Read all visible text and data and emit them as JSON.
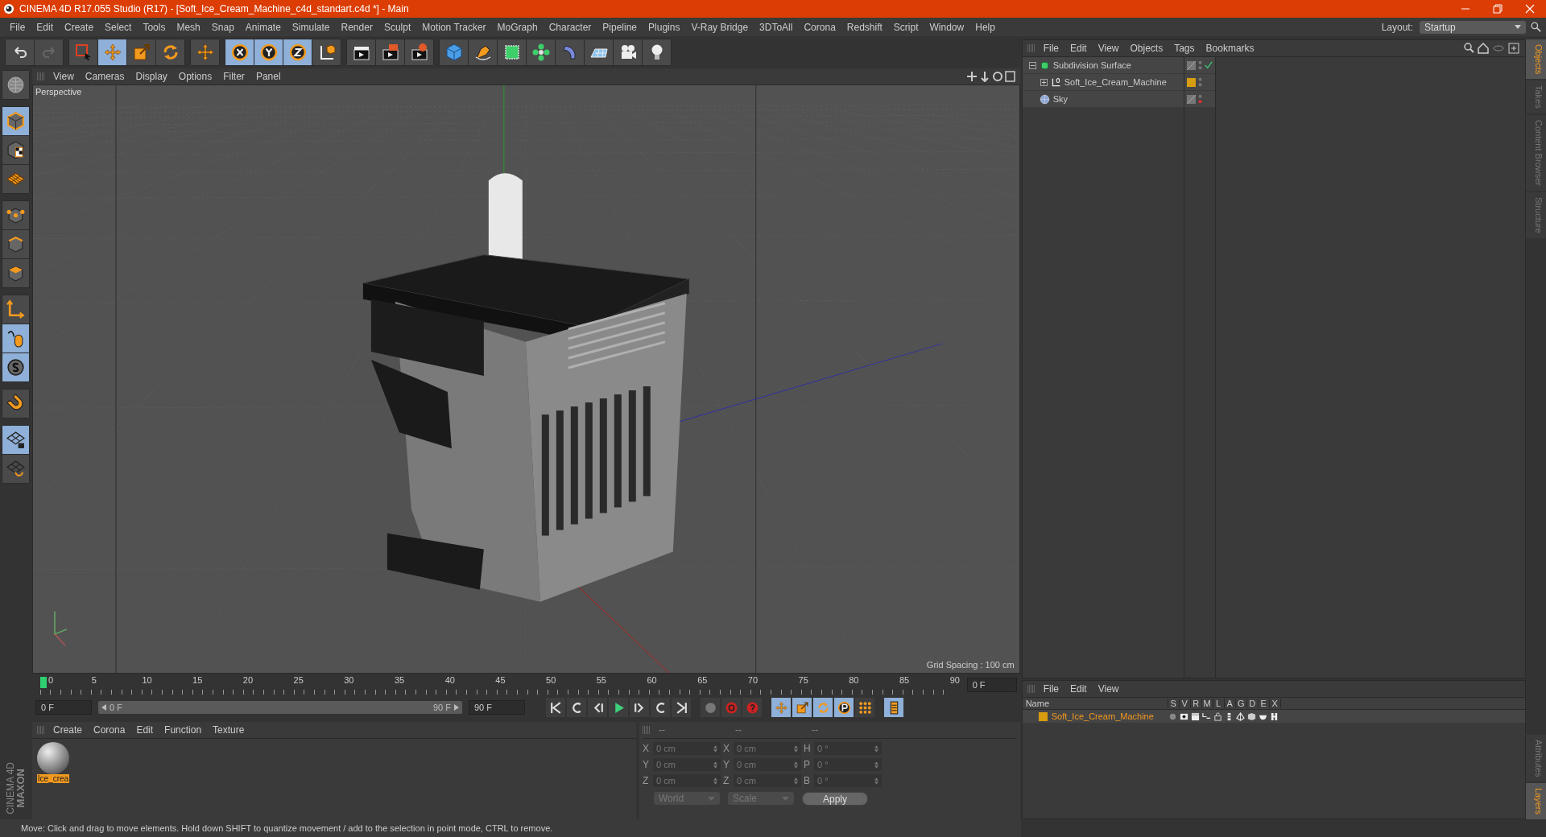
{
  "window": {
    "title": "CINEMA 4D R17.055 Studio (R17) - [Soft_Ice_Cream_Machine_c4d_standart.c4d *] - Main"
  },
  "menu": [
    "File",
    "Edit",
    "Create",
    "Select",
    "Tools",
    "Mesh",
    "Snap",
    "Animate",
    "Simulate",
    "Render",
    "Sculpt",
    "Motion Tracker",
    "MoGraph",
    "Character",
    "Pipeline",
    "Plugins",
    "V-Ray Bridge",
    "3DToAll",
    "Corona",
    "Redshift",
    "Script",
    "Window",
    "Help"
  ],
  "layout": {
    "label": "Layout:",
    "value": "Startup"
  },
  "viewport": {
    "menu": [
      "View",
      "Cameras",
      "Display",
      "Options",
      "Filter",
      "Panel"
    ],
    "camera": "Perspective",
    "grid_spacing": "Grid Spacing : 100 cm"
  },
  "timeline": {
    "ticks": [
      "0",
      "5",
      "10",
      "15",
      "20",
      "25",
      "30",
      "35",
      "40",
      "45",
      "50",
      "55",
      "60",
      "65",
      "70",
      "75",
      "80",
      "85",
      "90"
    ],
    "level": 0,
    "current_frame": "0 F",
    "start_field": "0 F",
    "range": {
      "start": "0 F",
      "end": "90 F"
    },
    "end_field": "90 F"
  },
  "material_manager": {
    "menu": [
      "Create",
      "Corona",
      "Edit",
      "Function",
      "Texture"
    ],
    "materials": [
      {
        "name": "Ice_crea",
        "selected": true
      }
    ]
  },
  "coordinates": {
    "headers": [
      "--",
      "--",
      "--"
    ],
    "rows": [
      [
        {
          "axis": "X",
          "value": "0 cm"
        },
        {
          "axis": "X",
          "value": "0 cm"
        },
        {
          "axis": "H",
          "value": "0 °"
        }
      ],
      [
        {
          "axis": "Y",
          "value": "0 cm"
        },
        {
          "axis": "Y",
          "value": "0 cm"
        },
        {
          "axis": "P",
          "value": "0 °"
        }
      ],
      [
        {
          "axis": "Z",
          "value": "0 cm"
        },
        {
          "axis": "Z",
          "value": "0 cm"
        },
        {
          "axis": "B",
          "value": "0 °"
        }
      ]
    ],
    "mode": "World",
    "transform": "Scale",
    "apply": "Apply"
  },
  "object_manager": {
    "menu": [
      "File",
      "Edit",
      "View",
      "Objects",
      "Tags",
      "Bookmarks"
    ],
    "objects": [
      {
        "name": "Subdivision Surface",
        "kind": "generator",
        "expanded": true,
        "enabled": true,
        "render_hidden": false,
        "children": [
          {
            "name": "Soft_Ice_Cream_Machine",
            "kind": "null",
            "expanded": false,
            "enabled": false,
            "render_hidden": false,
            "color": "#d89c10"
          }
        ]
      },
      {
        "name": "Sky",
        "kind": "sky",
        "enabled": false,
        "render_hidden": true
      }
    ]
  },
  "layer_manager": {
    "menu": [
      "File",
      "Edit",
      "View"
    ],
    "columns": [
      "Name",
      "S",
      "V",
      "R",
      "M",
      "L",
      "A",
      "G",
      "D",
      "E",
      "X"
    ],
    "layers": [
      {
        "name": "Soft_Ice_Cream_Machine",
        "color": "#d89c10"
      }
    ]
  },
  "side_tabs_top": [
    {
      "label": "Objects",
      "selected": true
    },
    {
      "label": "Takes",
      "selected": false
    },
    {
      "label": "Content Browser",
      "selected": false
    },
    {
      "label": "Structure",
      "selected": false
    }
  ],
  "side_tabs_bottom": [
    {
      "label": "Attributes",
      "selected": false
    },
    {
      "label": "Layers",
      "selected": true
    }
  ],
  "logo": {
    "brand": "MAXON",
    "product": "CINEMA 4D"
  },
  "status": "Move: Click and drag to move elements. Hold down SHIFT to quantize movement / add to the selection in point mode, CTRL to remove."
}
